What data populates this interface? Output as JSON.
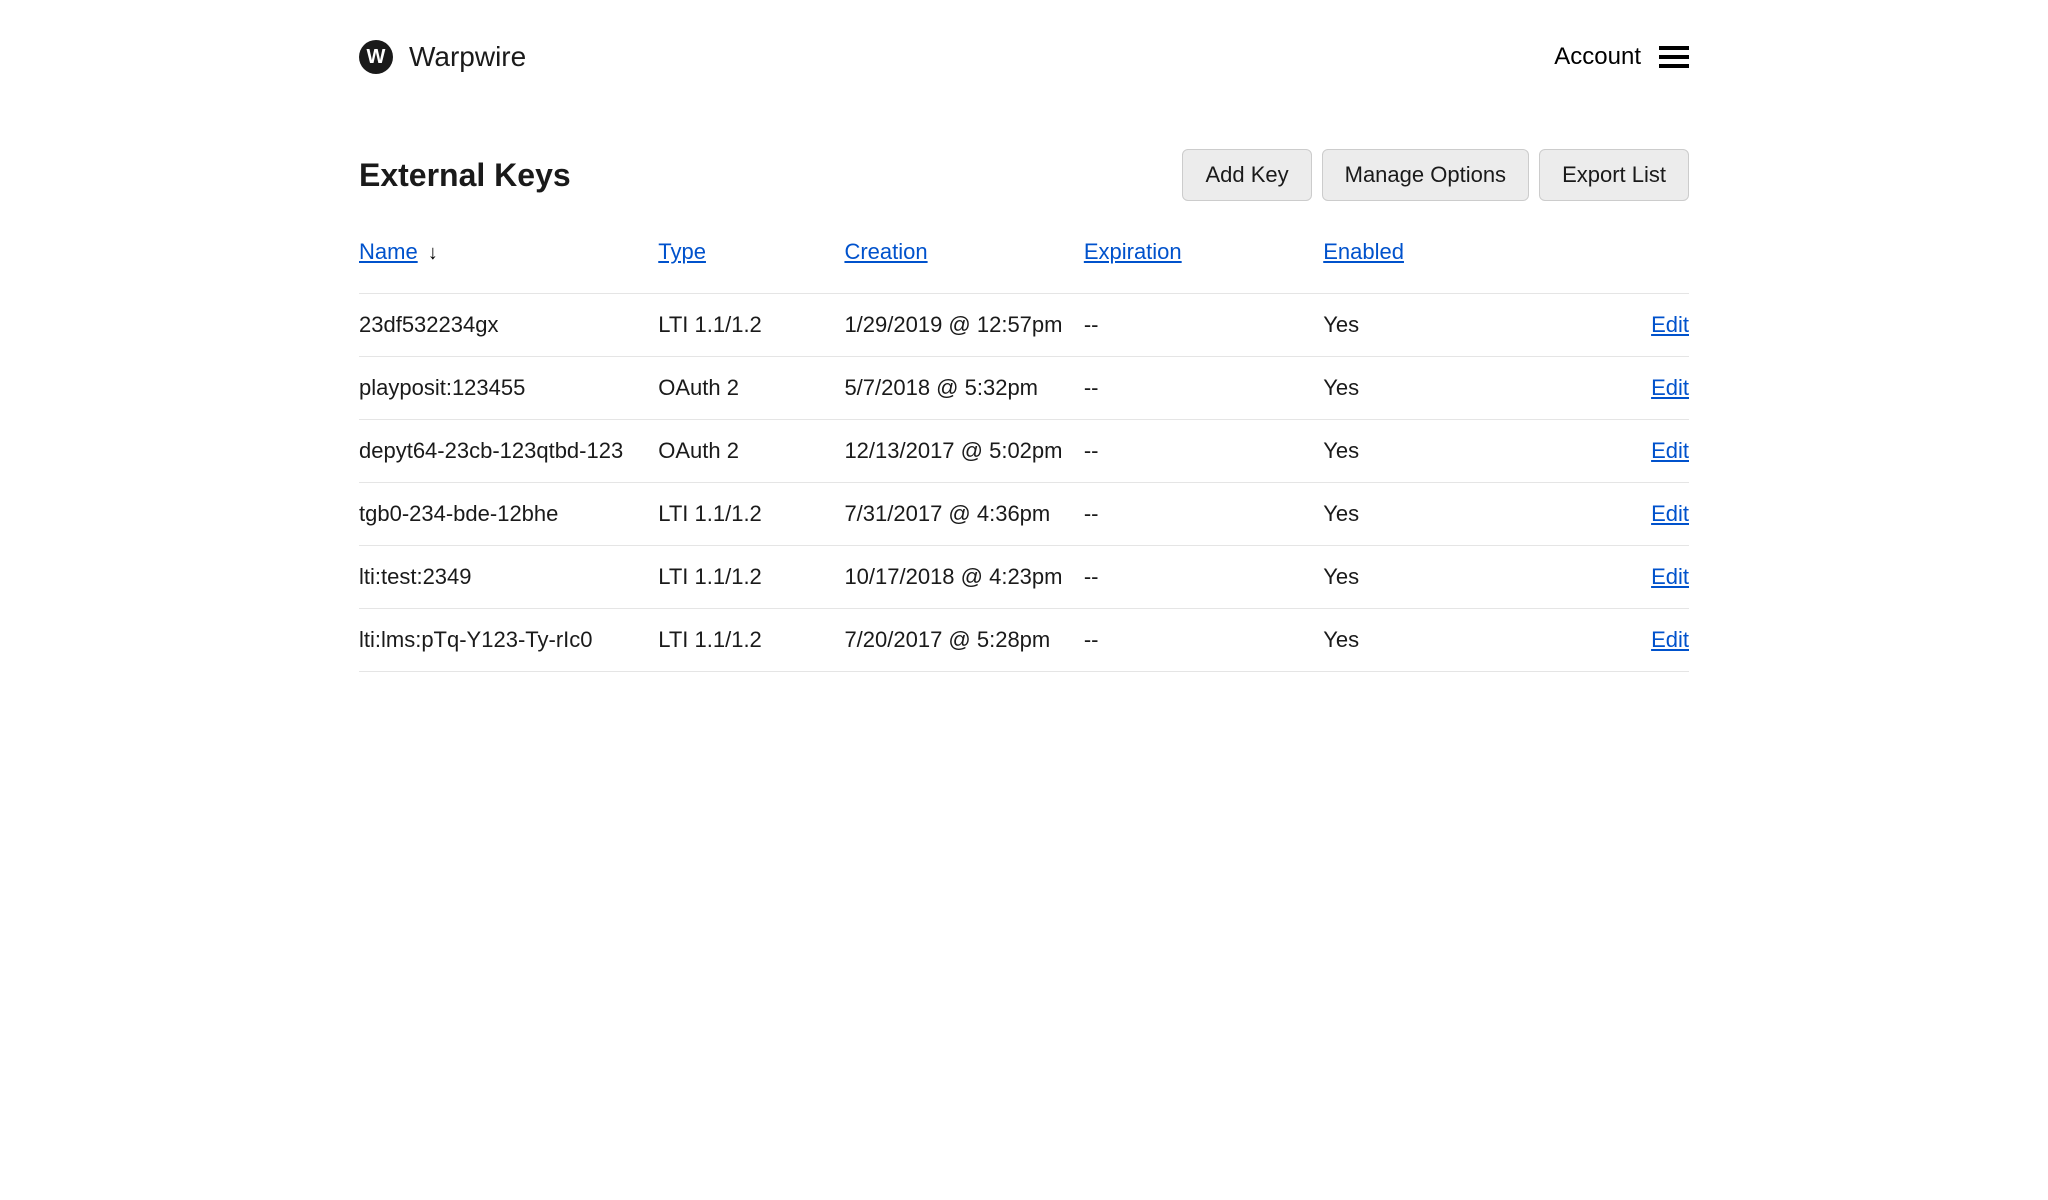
{
  "header": {
    "logo_text": "Warpwire",
    "account_label": "Account"
  },
  "page": {
    "title": "External Keys",
    "buttons": {
      "add_key": "Add Key",
      "manage_options": "Manage Options",
      "export_list": "Export List"
    }
  },
  "table": {
    "columns": {
      "name": "Name",
      "type": "Type",
      "creation": "Creation",
      "expiration": "Expiration",
      "enabled": "Enabled"
    },
    "sort_indicator": "↓",
    "edit_label": "Edit",
    "rows": [
      {
        "name": "23df532234gx",
        "type": "LTI 1.1/1.2",
        "creation": "1/29/2019 @ 12:57pm",
        "expiration": "--",
        "enabled": "Yes"
      },
      {
        "name": "playposit:123455",
        "type": "OAuth 2",
        "creation": "5/7/2018 @ 5:32pm",
        "expiration": "--",
        "enabled": "Yes"
      },
      {
        "name": "depyt64-23cb-123qtbd-123",
        "type": "OAuth 2",
        "creation": "12/13/2017 @ 5:02pm",
        "expiration": "--",
        "enabled": "Yes"
      },
      {
        "name": "tgb0-234-bde-12bhe",
        "type": "LTI 1.1/1.2",
        "creation": "7/31/2017 @ 4:36pm",
        "expiration": "--",
        "enabled": "Yes"
      },
      {
        "name": "lti:test:2349",
        "type": "LTI 1.1/1.2",
        "creation": "10/17/2018 @ 4:23pm",
        "expiration": "--",
        "enabled": "Yes"
      },
      {
        "name": "lti:lms:pTq-Y123-Ty-rIc0",
        "type": "LTI 1.1/1.2",
        "creation": "7/20/2017 @ 5:28pm",
        "expiration": "--",
        "enabled": "Yes"
      }
    ]
  }
}
